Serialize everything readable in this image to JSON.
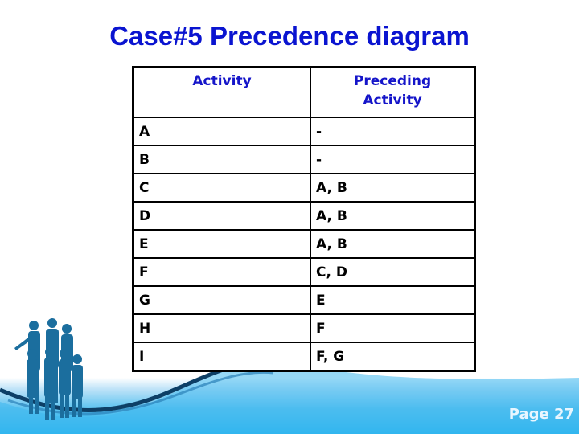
{
  "slide": {
    "title": "Case#5 Precedence diagram",
    "page_label": "Page 27"
  },
  "table": {
    "headers": [
      "Activity",
      "Preceding\nActivity"
    ],
    "header_activity": "Activity",
    "header_preceding_line1": "Preceding",
    "header_preceding_line2": "Activity",
    "rows": [
      {
        "activity": "A",
        "preceding": "-"
      },
      {
        "activity": "B",
        "preceding": "-"
      },
      {
        "activity": "C",
        "preceding": "A, B"
      },
      {
        "activity": "D",
        "preceding": "A, B"
      },
      {
        "activity": "E",
        "preceding": "A, B"
      },
      {
        "activity": "F",
        "preceding": "C, D"
      },
      {
        "activity": "G",
        "preceding": "E"
      },
      {
        "activity": "H",
        "preceding": "F"
      },
      {
        "activity": "I",
        "preceding": "F, G"
      }
    ]
  },
  "colors": {
    "title": "#0a14d0",
    "header_text": "#1515c9",
    "band_blue": "#22b3ef"
  }
}
